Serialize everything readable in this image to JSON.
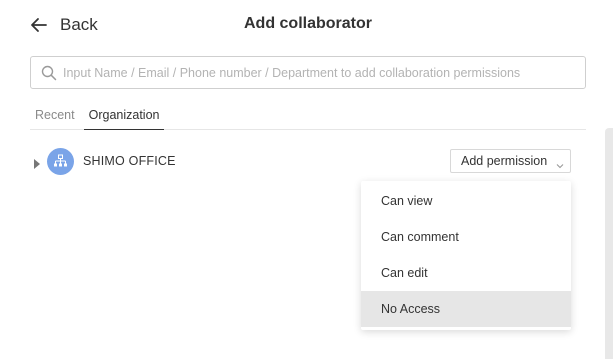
{
  "header": {
    "back_label": "Back",
    "title": "Add collaborator",
    "back_icon": "arrow-left-icon"
  },
  "search": {
    "placeholder": "Input Name / Email / Phone number / Department to add collaboration permissions",
    "value": "",
    "icon": "search-icon"
  },
  "tabs": [
    {
      "label": "Recent",
      "active": false
    },
    {
      "label": "Organization",
      "active": true
    }
  ],
  "organization": {
    "name": "SHIMO OFFICE",
    "avatar_icon": "org-chart-icon",
    "avatar_color": "#7aa4e8",
    "expand_icon": "caret-right-icon"
  },
  "permission_button": {
    "label": "Add permission",
    "icon": "chevron-down-icon"
  },
  "permission_menu": {
    "items": [
      {
        "label": "Can view"
      },
      {
        "label": "Can comment"
      },
      {
        "label": "Can edit"
      },
      {
        "label": "No Access",
        "highlighted": true
      }
    ]
  }
}
